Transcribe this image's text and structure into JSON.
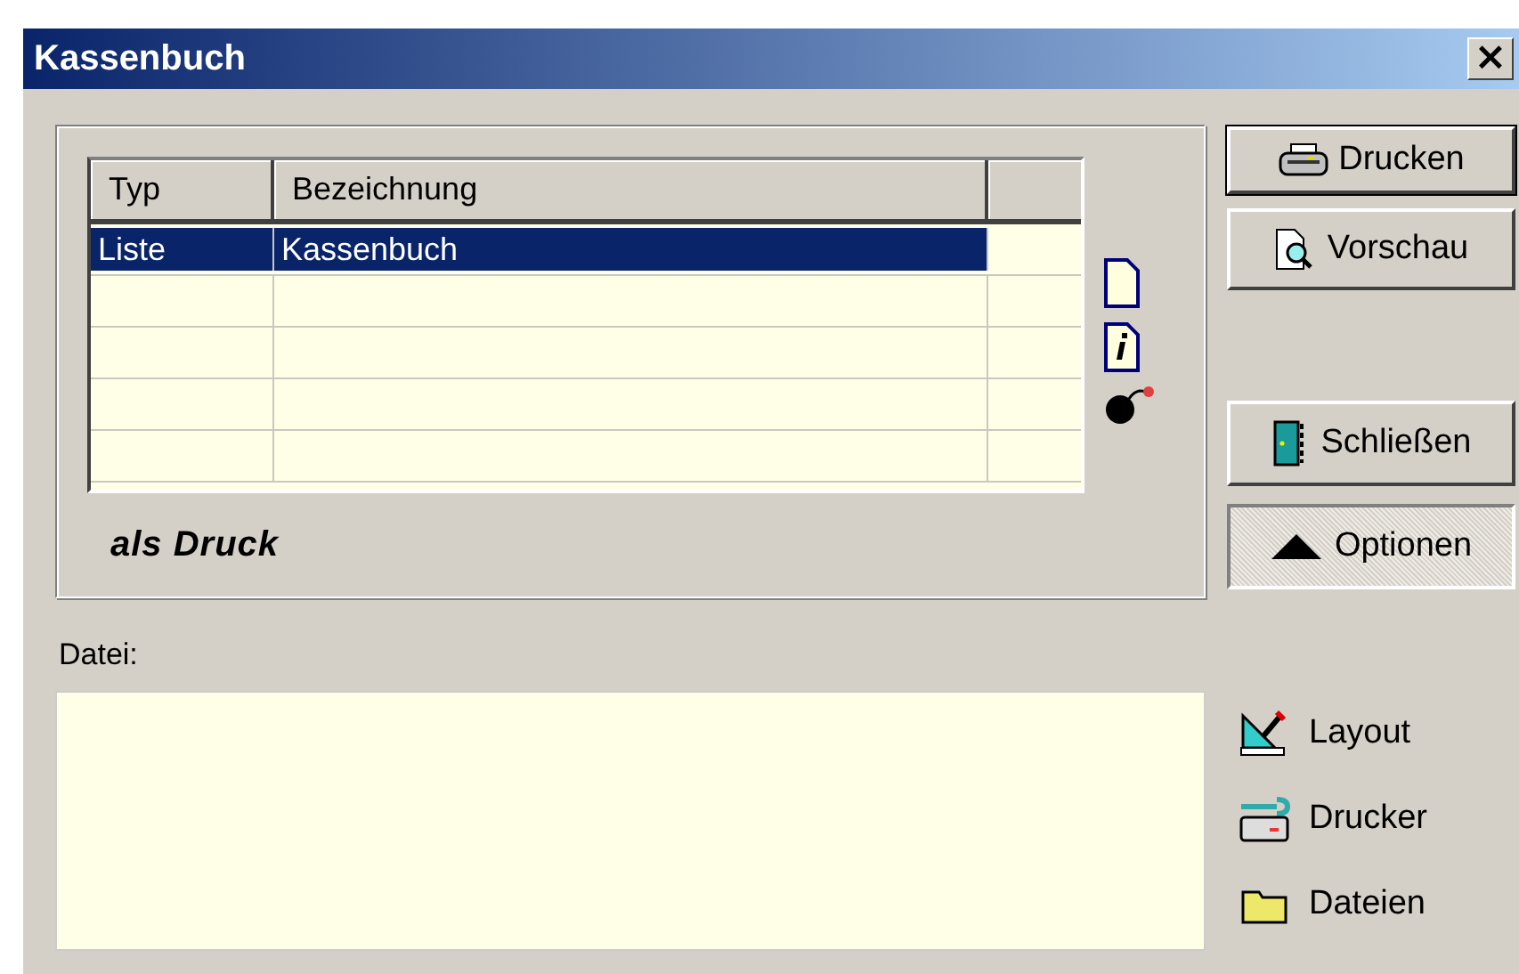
{
  "window": {
    "title": "Kassenbuch",
    "close": "×"
  },
  "table": {
    "columns": [
      "Typ",
      "Bezeichnung"
    ],
    "rows": [
      {
        "cells": [
          "Liste",
          "Kassenbuch"
        ],
        "selected": true
      },
      {
        "cells": [
          "",
          ""
        ],
        "selected": false
      },
      {
        "cells": [
          "",
          ""
        ],
        "selected": false
      },
      {
        "cells": [
          "",
          ""
        ],
        "selected": false
      },
      {
        "cells": [
          "",
          ""
        ],
        "selected": false
      }
    ]
  },
  "output_label": "als Druck",
  "buttons": [
    {
      "label": "Drucken",
      "kind": "print",
      "default": true
    },
    {
      "label": "Vorschau",
      "kind": "preview",
      "default": false
    },
    {
      "label": "Schließen",
      "kind": "close",
      "default": false
    },
    {
      "label": "Optionen",
      "kind": "options",
      "default": false
    }
  ],
  "file": {
    "label": "Datei:"
  },
  "links": [
    {
      "label": "Layout",
      "kind": "layout"
    },
    {
      "label": "Drucker",
      "kind": "printer"
    },
    {
      "label": "Dateien",
      "kind": "files"
    }
  ]
}
